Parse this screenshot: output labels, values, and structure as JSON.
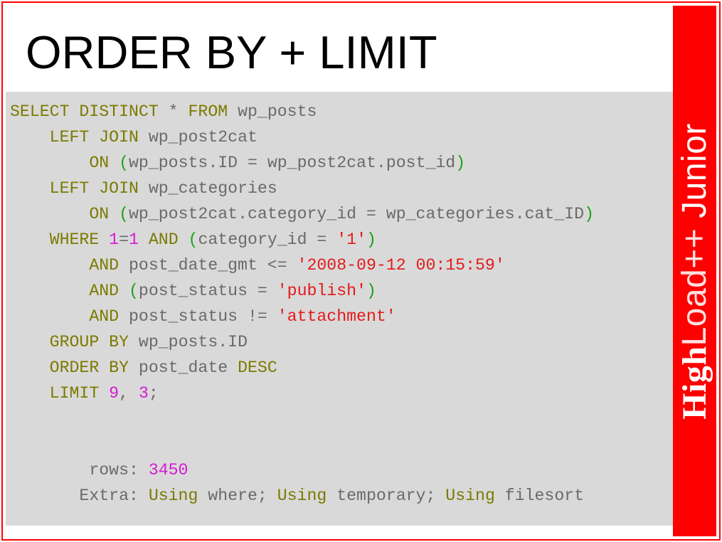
{
  "title": "ORDER BY + LIMIT",
  "sidebar": {
    "bold": "High",
    "l1": "Load++",
    "l2": " Junior"
  },
  "code": {
    "l1": {
      "kw1": "SELECT",
      "kw2": "DISTINCT",
      "star": " * ",
      "kw3": "FROM",
      "t1": " wp_posts"
    },
    "l2": {
      "kw1": "LEFT",
      "kw2": "JOIN",
      "t1": " wp_post2cat"
    },
    "l3": {
      "kw1": "ON",
      "p1": "(",
      "t1": "wp_posts.ID = wp_post2cat.post_id",
      "p2": ")"
    },
    "l4": {
      "kw1": "LEFT",
      "kw2": "JOIN",
      "t1": " wp_categories"
    },
    "l5": {
      "kw1": "ON",
      "p1": "(",
      "t1": "wp_post2cat.category_id = wp_categories.cat_ID",
      "p2": ")"
    },
    "l6": {
      "kw1": "WHERE",
      "n1": "1",
      "eq1": "=",
      "n2": "1",
      "kw2": "AND",
      "p1": "(",
      "t1": "category_id = ",
      "s1": "'1'",
      "p2": ")"
    },
    "l7": {
      "kw1": "AND",
      "t1": " post_date_gmt <= ",
      "s1": "'2008-09-12 00:15:59'"
    },
    "l8": {
      "kw1": "AND",
      "p1": "(",
      "t1": "post_status = ",
      "s1": "'publish'",
      "p2": ")"
    },
    "l9": {
      "kw1": "AND",
      "t1": " post_status != ",
      "s1": "'attachment'"
    },
    "l10": {
      "kw1": "GROUP",
      "kw2": "BY",
      "t1": " wp_posts.ID"
    },
    "l11": {
      "kw1": "ORDER",
      "kw2": "BY",
      "t1": " post_date ",
      "kw3": "DESC"
    },
    "l12": {
      "kw1": "LIMIT",
      "n1": "9",
      "c1": ", ",
      "n2": "3",
      "semi": ";"
    },
    "l15": {
      "lbl": " rows: ",
      "n1": "3450"
    },
    "l16": {
      "lbl": "Extra: ",
      "kw1": "Using",
      "t1": " where; ",
      "kw2": "Using",
      "t2": " temporary; ",
      "kw3": "Using",
      "t3": " filesort"
    }
  }
}
